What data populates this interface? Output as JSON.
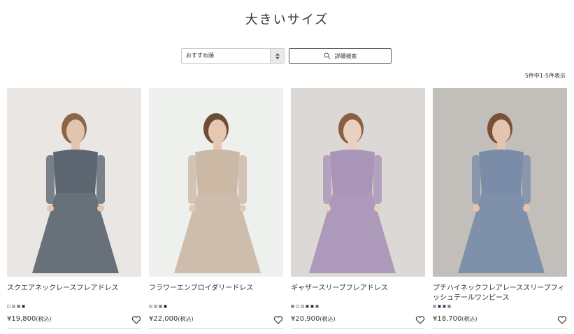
{
  "page": {
    "title": "大きいサイズ"
  },
  "sort": {
    "selected": "おすすめ順",
    "stepper_icon": "up-down-arrows"
  },
  "search_button": {
    "label": "詳細検索",
    "icon": "search-icon"
  },
  "result_count": "5件中1-5件表示",
  "products": [
    {
      "name": "スクエアネックレースフレアドレス",
      "price": "¥19,800",
      "tax": "(税込)",
      "swatches": [
        "#eeeeee",
        "#9fb89a",
        "#5b6b78",
        "#1a1f2e"
      ],
      "bg": "#e9e6e3",
      "dress": "#5c6670",
      "skin": "#e3c4ae",
      "hair": "#8a6548"
    },
    {
      "name": "フラワーエンブロイダリードレス",
      "price": "¥22,000",
      "tax": "(税込)",
      "swatches": [
        "#e2c2bd",
        "#a8b5a0",
        "#8a6a68",
        "#111111"
      ],
      "bg": "#eef0ee",
      "dress": "#cbb9a6",
      "skin": "#e6c8b2",
      "hair": "#6e4d38"
    },
    {
      "name": "ギャザースリーブフレアドレス",
      "price": "¥20,900",
      "tax": "(税込)",
      "swatches": [
        "#5f7a99",
        "#f0e6c0",
        "#cbb8c8",
        "#6a1a2a",
        "#1a1f3a",
        "#4a5a60"
      ],
      "bg": "#dcd8d6",
      "dress": "#a895b8",
      "skin": "#ead0be",
      "hair": "#8a5e40"
    },
    {
      "name": "プチハイネックフレアレーススリーブフィッシュテールワンピース",
      "price": "¥18,700",
      "tax": "(税込)",
      "swatches": [
        "#9b9bc8",
        "#1a2440",
        "#2a3f5a",
        "#a06a58"
      ],
      "bg": "#c2bfbb",
      "dress": "#7a8ca8",
      "skin": "#e4c4ae",
      "hair": "#7a5036"
    }
  ]
}
